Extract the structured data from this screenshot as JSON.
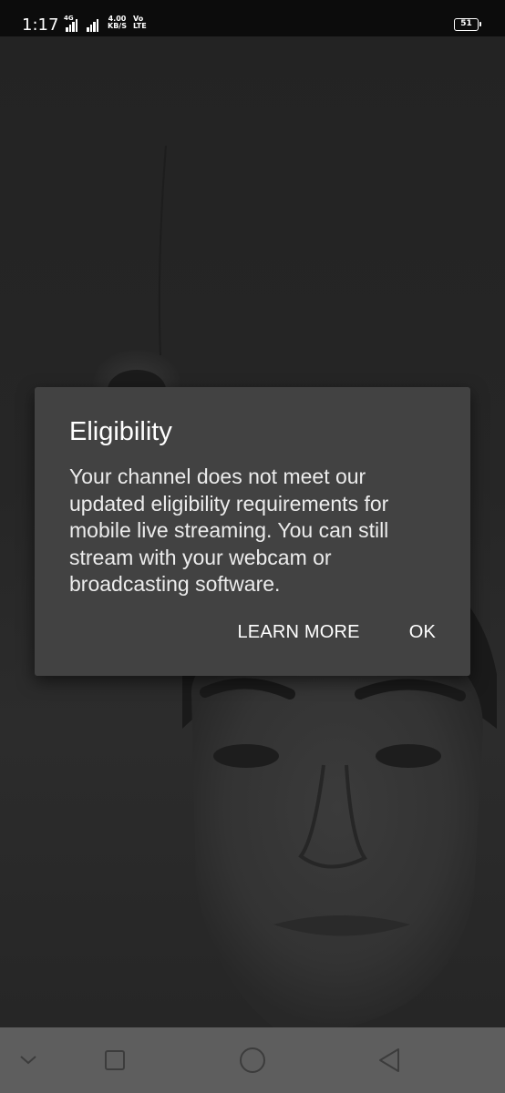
{
  "status_bar": {
    "time": "1:17",
    "network_type": "4G",
    "net_speed_value": "4.00",
    "net_speed_unit": "KB/S",
    "volte_line1": "Vo",
    "volte_line2": "LTE",
    "battery_level": "51",
    "icons": [
      "signal-icon",
      "signal-icon",
      "battery-icon"
    ]
  },
  "dialog": {
    "title": "Eligibility",
    "message": "Your channel does not meet our updated eligibility requirements for mobile live streaming. You can still stream with your webcam or broadcasting software.",
    "learn_more_label": "LEARN MORE",
    "ok_label": "OK"
  },
  "nav_bar": {
    "icons": [
      "chevron-down-icon",
      "recents-square-icon",
      "home-circle-icon",
      "back-triangle-icon"
    ]
  },
  "colors": {
    "status_bar_bg": "#0c0c0c",
    "scrim_bg": "#222222",
    "dialog_bg": "#424242",
    "nav_bar_bg": "#5e5e5e",
    "text": "#ffffff"
  }
}
